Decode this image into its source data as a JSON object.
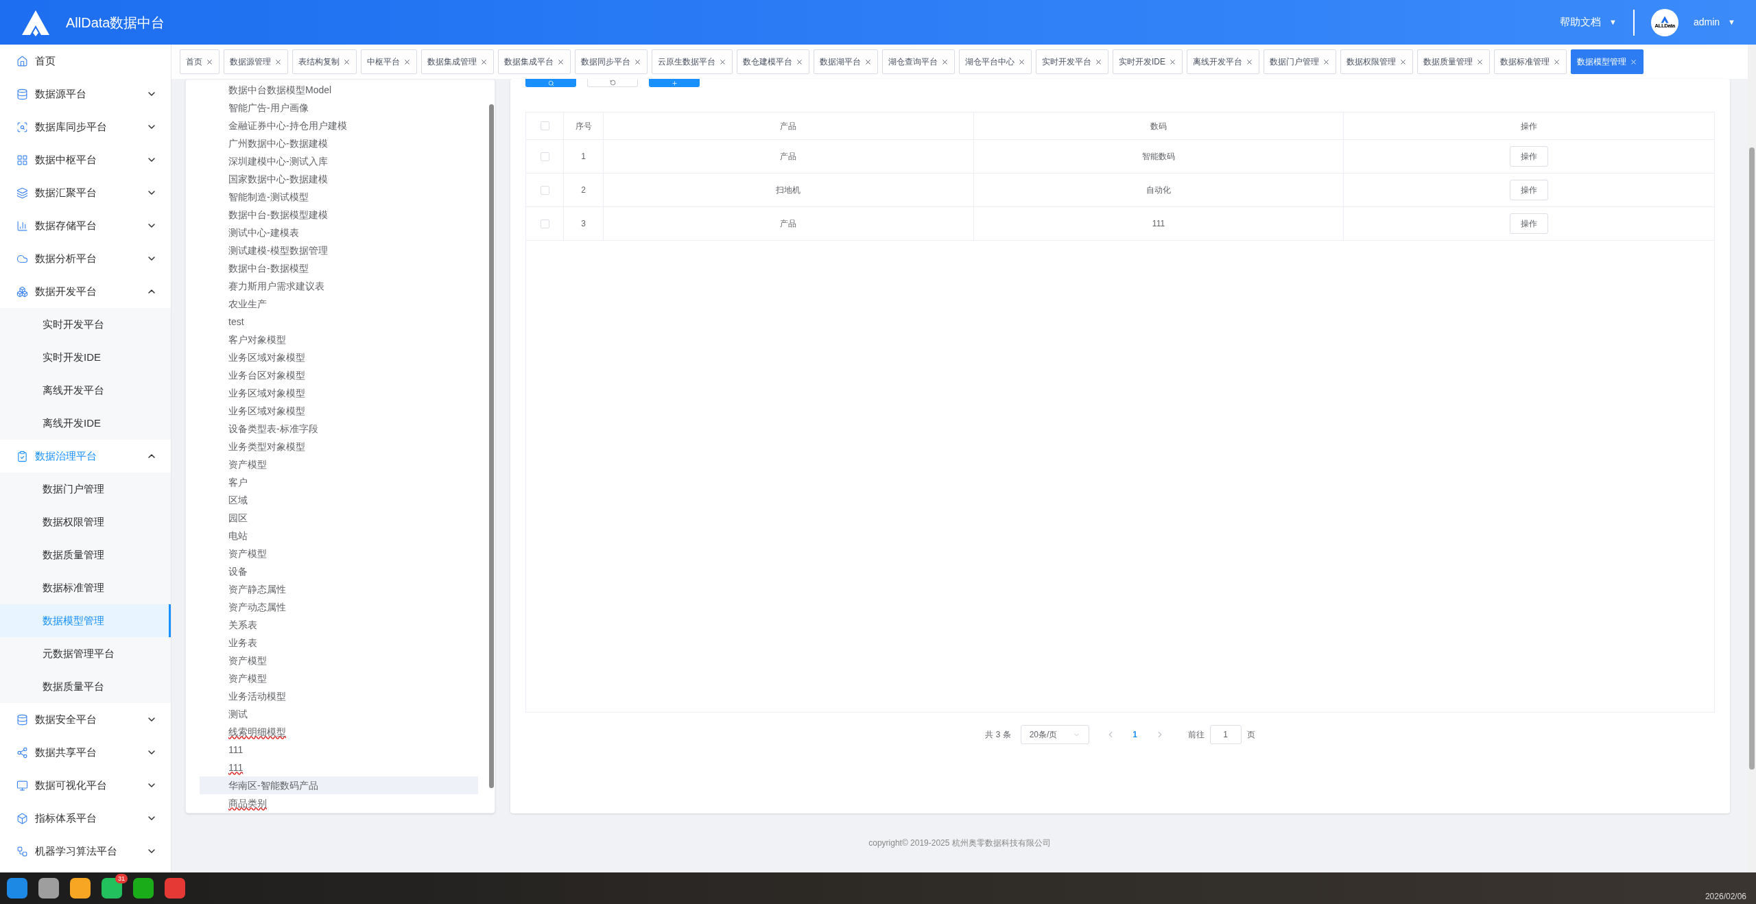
{
  "header": {
    "brand": "AllData数据中台",
    "help": "帮助文档",
    "help_caret": "▼",
    "user": "admin",
    "user_caret": "▼",
    "avatar_text": "ALLData"
  },
  "sidebar": {
    "items": [
      {
        "label": "首页",
        "has_children": false,
        "active": false
      },
      {
        "label": "数据源平台",
        "expanded": false,
        "has_children": true,
        "active": false
      },
      {
        "label": "数据库同步平台",
        "expanded": false,
        "has_children": true,
        "active": false
      },
      {
        "label": "数据中枢平台",
        "expanded": false,
        "has_children": true,
        "active": false
      },
      {
        "label": "数据汇聚平台",
        "expanded": false,
        "has_children": true,
        "active": false
      },
      {
        "label": "数据存储平台",
        "expanded": false,
        "has_children": true,
        "active": false
      },
      {
        "label": "数据分析平台",
        "expanded": false,
        "has_children": true,
        "active": false
      },
      {
        "label": "数据开发平台",
        "expanded": true,
        "has_children": true,
        "active": false,
        "children": [
          {
            "label": "实时开发平台",
            "selected": false
          },
          {
            "label": "实时开发IDE",
            "selected": false
          },
          {
            "label": "离线开发平台",
            "selected": false
          },
          {
            "label": "离线开发IDE",
            "selected": false
          }
        ]
      },
      {
        "label": "数据治理平台",
        "expanded": true,
        "has_children": true,
        "active": true,
        "children": [
          {
            "label": "数据门户管理",
            "selected": false
          },
          {
            "label": "数据权限管理",
            "selected": false
          },
          {
            "label": "数据质量管理",
            "selected": false
          },
          {
            "label": "数据标准管理",
            "selected": false
          },
          {
            "label": "数据模型管理",
            "selected": true
          },
          {
            "label": "元数据管理平台",
            "selected": false
          },
          {
            "label": "数据质量平台",
            "selected": false
          }
        ]
      },
      {
        "label": "数据安全平台",
        "expanded": false,
        "has_children": true,
        "active": false
      },
      {
        "label": "数据共享平台",
        "expanded": false,
        "has_children": true,
        "active": false
      },
      {
        "label": "数据可视化平台",
        "expanded": false,
        "has_children": true,
        "active": false
      },
      {
        "label": "指标体系平台",
        "expanded": false,
        "has_children": true,
        "active": false
      },
      {
        "label": "机器学习算法平台",
        "expanded": false,
        "has_children": true,
        "active": false
      }
    ]
  },
  "tabs": [
    {
      "label": "首页",
      "selected": false
    },
    {
      "label": "数据源管理",
      "selected": false
    },
    {
      "label": "表结构复制",
      "selected": false
    },
    {
      "label": "中枢平台",
      "selected": false
    },
    {
      "label": "数据集成管理",
      "selected": false
    },
    {
      "label": "数据集成平台",
      "selected": false
    },
    {
      "label": "数据同步平台",
      "selected": false
    },
    {
      "label": "云原生数据平台",
      "selected": false
    },
    {
      "label": "数仓建模平台",
      "selected": false
    },
    {
      "label": "数据湖平台",
      "selected": false
    },
    {
      "label": "湖仓查询平台",
      "selected": false
    },
    {
      "label": "湖仓平台中心",
      "selected": false
    },
    {
      "label": "实时开发平台",
      "selected": false
    },
    {
      "label": "实时开发IDE",
      "selected": false
    },
    {
      "label": "离线开发平台",
      "selected": false
    },
    {
      "label": "数据门户管理",
      "selected": false
    },
    {
      "label": "数据权限管理",
      "selected": false
    },
    {
      "label": "数据质量管理",
      "selected": false
    },
    {
      "label": "数据标准管理",
      "selected": false
    },
    {
      "label": "数据模型管理",
      "selected": true
    }
  ],
  "tree": {
    "items": [
      {
        "label": "数据中台数据模型Model",
        "selected": false,
        "flagged": false
      },
      {
        "label": "智能广告-用户画像",
        "selected": false,
        "flagged": false
      },
      {
        "label": "金融证券中心-持仓用户建模",
        "selected": false,
        "flagged": false
      },
      {
        "label": "广州数据中心-数据建模",
        "selected": false,
        "flagged": false
      },
      {
        "label": "深圳建模中心-测试入库",
        "selected": false,
        "flagged": false
      },
      {
        "label": "国家数据中心-数据建模",
        "selected": false,
        "flagged": false
      },
      {
        "label": "智能制造-测试模型",
        "selected": false,
        "flagged": false
      },
      {
        "label": "数据中台-数据模型建模",
        "selected": false,
        "flagged": false
      },
      {
        "label": "测试中心-建模表",
        "selected": false,
        "flagged": false
      },
      {
        "label": "测试建模-模型数据管理",
        "selected": false,
        "flagged": false
      },
      {
        "label": "数据中台-数据模型",
        "selected": false,
        "flagged": false
      },
      {
        "label": "赛力斯用户需求建议表",
        "selected": false,
        "flagged": false
      },
      {
        "label": "农业生产",
        "selected": false,
        "flagged": false
      },
      {
        "label": "test",
        "selected": false,
        "flagged": false
      },
      {
        "label": "客户对象模型",
        "selected": false,
        "flagged": false
      },
      {
        "label": "业务区域对象模型",
        "selected": false,
        "flagged": false
      },
      {
        "label": "业务台区对象模型",
        "selected": false,
        "flagged": false
      },
      {
        "label": "业务区域对象模型",
        "selected": false,
        "flagged": false
      },
      {
        "label": "业务区域对象模型",
        "selected": false,
        "flagged": false
      },
      {
        "label": "设备类型表-标准字段",
        "selected": false,
        "flagged": false
      },
      {
        "label": "业务类型对象模型",
        "selected": false,
        "flagged": false
      },
      {
        "label": "资产模型",
        "selected": false,
        "flagged": false
      },
      {
        "label": "客户",
        "selected": false,
        "flagged": false
      },
      {
        "label": "区域",
        "selected": false,
        "flagged": false
      },
      {
        "label": "园区",
        "selected": false,
        "flagged": false
      },
      {
        "label": "电站",
        "selected": false,
        "flagged": false
      },
      {
        "label": "资产模型",
        "selected": false,
        "flagged": false
      },
      {
        "label": "设备",
        "selected": false,
        "flagged": false
      },
      {
        "label": "资产静态属性",
        "selected": false,
        "flagged": false
      },
      {
        "label": "资产动态属性",
        "selected": false,
        "flagged": false
      },
      {
        "label": "关系表",
        "selected": false,
        "flagged": false
      },
      {
        "label": "业务表",
        "selected": false,
        "flagged": false
      },
      {
        "label": "资产模型",
        "selected": false,
        "flagged": false
      },
      {
        "label": "资产模型",
        "selected": false,
        "flagged": false
      },
      {
        "label": "业务活动模型",
        "selected": false,
        "flagged": false
      },
      {
        "label": "测试",
        "selected": false,
        "flagged": false
      },
      {
        "label": "线索明细模型",
        "selected": false,
        "flagged": true
      },
      {
        "label": "111",
        "selected": false,
        "flagged": false
      },
      {
        "label": "111",
        "selected": false,
        "flagged": true
      },
      {
        "label": "华南区-智能数码产品",
        "selected": true,
        "flagged": false
      },
      {
        "label": "商品类别",
        "selected": false,
        "flagged": true
      }
    ]
  },
  "table": {
    "all_checked": false,
    "columns": [
      "序号",
      "产品",
      "数码",
      "操作"
    ],
    "rows": [
      {
        "index": "1",
        "product": "产品",
        "digital": "智能数码",
        "action": "操作",
        "checked": false
      },
      {
        "index": "2",
        "product": "扫地机",
        "digital": "自动化",
        "action": "操作",
        "checked": false
      },
      {
        "index": "3",
        "product": "产品",
        "digital": "111",
        "action": "操作",
        "checked": false
      }
    ]
  },
  "pagination": {
    "total": "共 3 条",
    "page_size": "20条/页",
    "current": "1",
    "goto_label": "前往",
    "goto_value": "1",
    "page_suffix": "页"
  },
  "footer": "copyright© 2019-2025 杭州奥零数据科技有限公司",
  "taskbar": {
    "badge": "31",
    "date": "2026/02/06"
  }
}
